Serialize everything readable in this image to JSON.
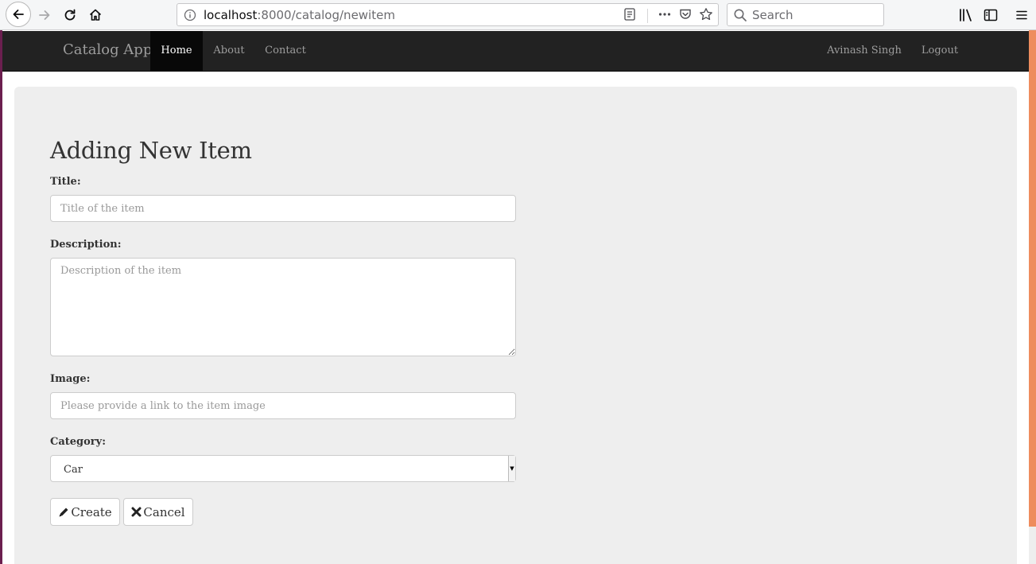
{
  "browser": {
    "url_host": "localhost",
    "url_path": ":8000/catalog/newitem",
    "search_placeholder": "Search"
  },
  "navbar": {
    "brand": "Catalog App",
    "items": [
      {
        "label": "Home",
        "active": true
      },
      {
        "label": "About",
        "active": false
      },
      {
        "label": "Contact",
        "active": false
      }
    ],
    "user": "Avinash Singh",
    "logout": "Logout"
  },
  "form": {
    "heading": "Adding New Item",
    "title_label": "Title:",
    "title_placeholder": "Title of the item",
    "description_label": "Description:",
    "description_placeholder": "Description of the item",
    "image_label": "Image:",
    "image_placeholder": "Please provide a link to the item image",
    "category_label": "Category:",
    "category_value": "Car",
    "create_label": "Create",
    "cancel_label": "Cancel"
  },
  "colors": {
    "navbar_bg": "#222222",
    "navbar_active_bg": "#080808",
    "panel_bg": "#eeeeee",
    "scrollbar_accent": "#ee8c5d",
    "window_edge": "#6b1f4f"
  }
}
